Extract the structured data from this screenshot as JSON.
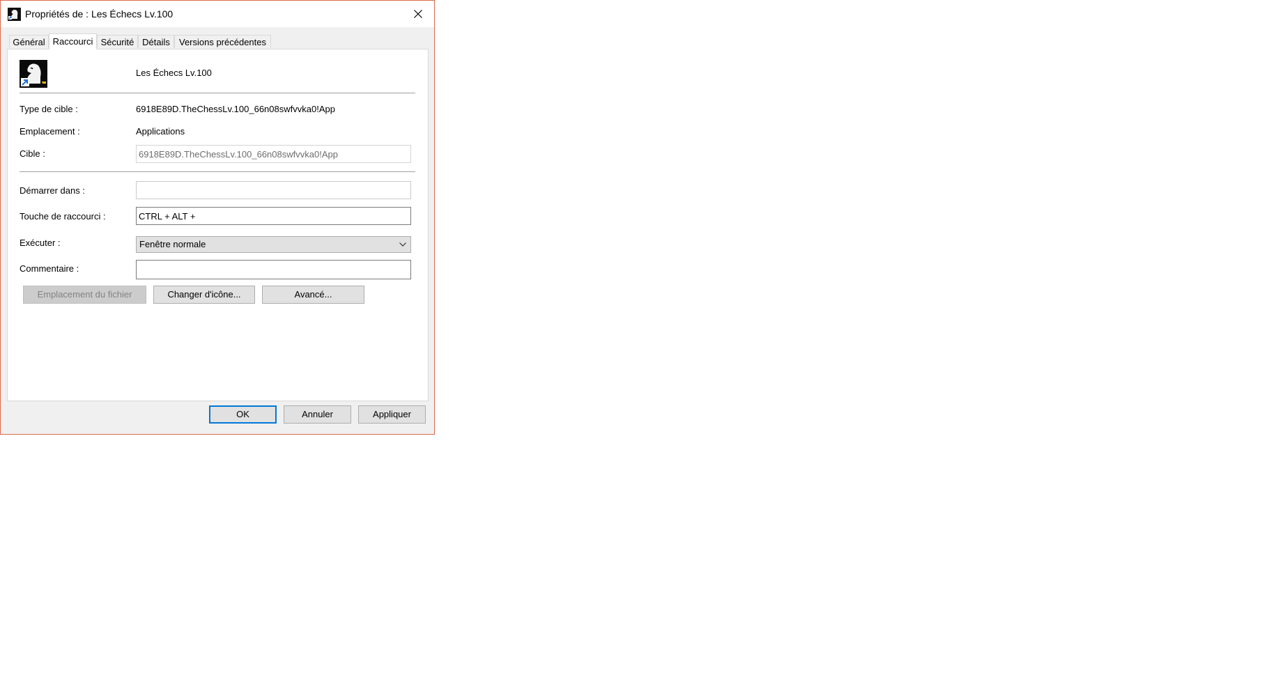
{
  "window": {
    "title": "Propriétés de : Les Échecs Lv.100",
    "icon": "chess-knight-icon"
  },
  "tabs": [
    {
      "label": "Général"
    },
    {
      "label": "Raccourci",
      "active": true
    },
    {
      "label": "Sécurité"
    },
    {
      "label": "Détails"
    },
    {
      "label": "Versions précédentes"
    }
  ],
  "shortcut": {
    "app_icon": "chess-knight-icon",
    "app_name": "Les Échecs Lv.100",
    "target_type_label": "Type de cible :",
    "target_type_value": "6918E89D.TheChessLv.100_66n08swfvvka0!App",
    "location_label": "Emplacement :",
    "location_value": "Applications",
    "target_label": "Cible :",
    "target_value": "6918E89D.TheChessLv.100_66n08swfvvka0!App",
    "start_in_label": "Démarrer dans :",
    "start_in_value": "",
    "hotkey_label": "Touche de raccourci :",
    "hotkey_value": "CTRL + ALT +",
    "run_label": "Exécuter :",
    "run_value": "Fenêtre normale",
    "comment_label": "Commentaire :",
    "comment_value": "",
    "buttons": {
      "open_location": "Emplacement du fichier",
      "change_icon": "Changer d'icône...",
      "advanced": "Avancé..."
    }
  },
  "footer": {
    "ok": "OK",
    "cancel": "Annuler",
    "apply": "Appliquer"
  },
  "colors": {
    "window_border": "#d9694f",
    "default_button_border": "#0078d7"
  }
}
